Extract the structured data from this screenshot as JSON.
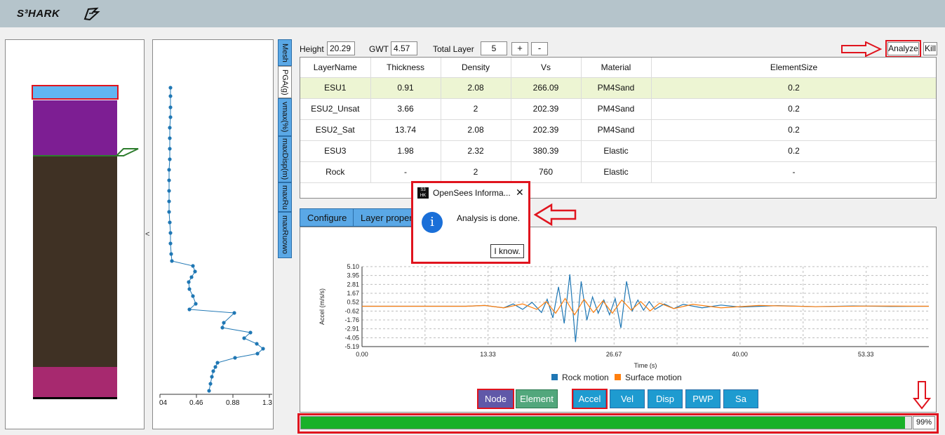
{
  "app": {
    "title": "S³HARK"
  },
  "profile_plot": {
    "ticks": [
      "04",
      "0.46",
      "0.88",
      "1.3"
    ],
    "collapse_glyph": "<"
  },
  "side_tabs": [
    "Mesh",
    "PGA(g)",
    "vmax(%)",
    "maxDisp(m)",
    "maxRu",
    "maxRuowo"
  ],
  "form": {
    "height_label": "Height",
    "height_value": "20.29",
    "gwt_label": "GWT",
    "gwt_value": "4.57",
    "total_layer_label": "Total Layer",
    "total_layer_value": "5",
    "plus": "+",
    "minus": "-",
    "analyze": "Analyze",
    "kill": "Kill"
  },
  "table": {
    "headers": [
      "LayerName",
      "Thickness",
      "Density",
      "Vs",
      "Material",
      "ElementSize"
    ],
    "rows": [
      [
        "ESU1",
        "0.91",
        "2.08",
        "266.09",
        "PM4Sand",
        "0.2"
      ],
      [
        "ESU2_Unsat",
        "3.66",
        "2",
        "202.39",
        "PM4Sand",
        "0.2"
      ],
      [
        "ESU2_Sat",
        "13.74",
        "2.08",
        "202.39",
        "PM4Sand",
        "0.2"
      ],
      [
        "ESU3",
        "1.98",
        "2.32",
        "380.39",
        "Elastic",
        "0.2"
      ],
      [
        "Rock",
        "-",
        "2",
        "760",
        "Elastic",
        "-"
      ]
    ]
  },
  "bottom_tabs": [
    "Configure",
    "Layer proper"
  ],
  "chart_data": {
    "type": "line",
    "ylabel": "Accel (m/s/s)",
    "xlabel": "Time (s)",
    "yticks": [
      "5.10",
      "3.95",
      "2.81",
      "1.67",
      "0.52",
      "-0.62",
      "-1.76",
      "-2.91",
      "-4.05",
      "-5.19"
    ],
    "xticks": [
      "0.00",
      "13.33",
      "26.67",
      "40.00",
      "53.33"
    ],
    "xlim": [
      0,
      60
    ],
    "ylim": [
      -5.19,
      5.1
    ],
    "grid": true,
    "legend_position": "bottom",
    "series": [
      {
        "name": "Rock motion",
        "color": "#1f77b4",
        "x": [
          0,
          11,
          13,
          15,
          16,
          17,
          18,
          19,
          19.6,
          20.2,
          20.8,
          21.4,
          22,
          22.6,
          23.2,
          23.8,
          24.4,
          25,
          25.6,
          26.2,
          26.8,
          27.4,
          28,
          28.6,
          29.2,
          29.8,
          30.4,
          31,
          32,
          33,
          34,
          36,
          38,
          40,
          44,
          48,
          52,
          56,
          60
        ],
        "values": [
          0,
          0,
          0.1,
          -0.2,
          0.3,
          -0.4,
          0.5,
          -0.8,
          0.9,
          -1.5,
          2.5,
          -2.2,
          4.1,
          -4.6,
          3.2,
          -1.8,
          1.2,
          -0.9,
          0.8,
          -1.1,
          1.0,
          -2.8,
          3.2,
          -0.6,
          0.8,
          -0.5,
          0.6,
          -0.4,
          0.3,
          -0.3,
          0.25,
          -0.2,
          0.15,
          -0.1,
          0.08,
          -0.05,
          0.04,
          -0.02,
          0
        ]
      },
      {
        "name": "Surface motion",
        "color": "#ff7f0e",
        "x": [
          0,
          11,
          13,
          15,
          17,
          18.5,
          19.5,
          20.5,
          21.5,
          22.5,
          23.5,
          24.5,
          25.5,
          26.5,
          27.5,
          28.5,
          29.5,
          30.5,
          31.5,
          33,
          35,
          38,
          42,
          48,
          54,
          60
        ],
        "values": [
          0,
          0,
          0.1,
          -0.2,
          0.3,
          -0.4,
          0.6,
          -0.9,
          1.0,
          -1.1,
          0.9,
          -0.8,
          0.7,
          -0.9,
          0.8,
          -0.5,
          0.6,
          -0.6,
          0.4,
          -0.3,
          0.25,
          -0.2,
          0.1,
          -0.05,
          0.03,
          0
        ]
      }
    ]
  },
  "buttons": [
    "Node",
    "Element",
    "Accel",
    "Vel",
    "Disp",
    "PWP",
    "Sa"
  ],
  "progress": {
    "value": 0.99,
    "label": "99%"
  },
  "dialog": {
    "title": "OpenSees Informa...",
    "message": "Analysis is done.",
    "ok": "I know.",
    "close": "✕",
    "info_glyph": "i",
    "icon_text": "S3 HK"
  },
  "colors": {
    "top_layer": "#61b6f2",
    "layer2": "#7d1e93",
    "layer3": "#3f3124",
    "rock": "#a7296f",
    "accent_blue": "#1e9bd0",
    "progress_green": "#19b128",
    "highlight_red": "#e0141e"
  }
}
